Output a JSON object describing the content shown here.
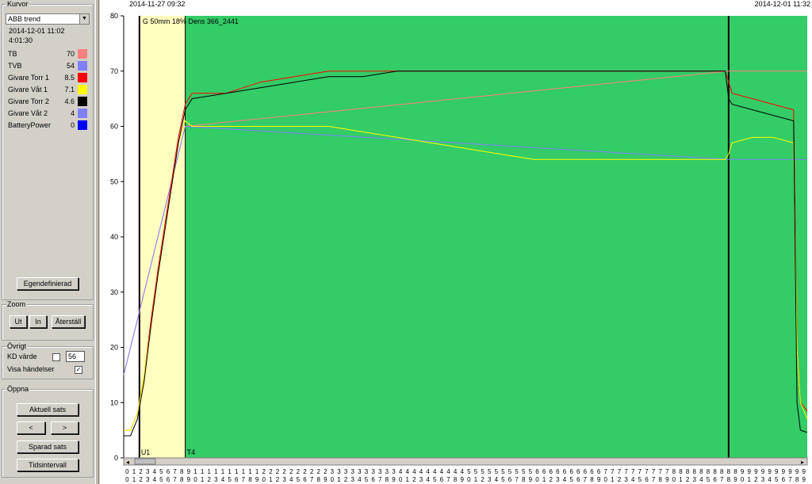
{
  "sidebar": {
    "kurvor": {
      "title": "Kurvor",
      "dropdown_value": "ABB trend",
      "datetime": "2014-12-01 11:02",
      "duration": "4:01:30",
      "legend": [
        {
          "name": "TB",
          "value": "70",
          "color": "#ff8080"
        },
        {
          "name": "TVB",
          "value": "54",
          "color": "#8080ff"
        },
        {
          "name": "Givare Torr 1",
          "value": "8.5",
          "color": "#ff0000"
        },
        {
          "name": "Givare Våt 1",
          "value": "7.1",
          "color": "#ffff00"
        },
        {
          "name": "Givare Torr 2",
          "value": "4.6",
          "color": "#000000"
        },
        {
          "name": "Givare Våt 2",
          "value": "4",
          "color": "#8080ff"
        },
        {
          "name": "BatteryPower",
          "value": "0",
          "color": "#0000ff"
        }
      ],
      "custom_button": "Egendefinierad"
    },
    "zoom": {
      "title": "Zoom",
      "out": "Ut",
      "in": "In",
      "reset": "Återställ"
    },
    "ovrigt": {
      "title": "Övrigt",
      "kd_label": "KD värde",
      "kd_value": "56",
      "kd_checked": false,
      "events_label": "Visa händelser",
      "events_checked": true
    },
    "oppna": {
      "title": "Öppna",
      "current_batch": "Aktuell sats",
      "prev": "<",
      "next": ">",
      "saved_batch": "Sparad sats",
      "time_interval": "Tidsintervall"
    }
  },
  "chart": {
    "start_date": "2014-11-27 09:32",
    "end_date": "2014-12-01 11:32",
    "annotation": "G 50mm 18% Dens 366_2441",
    "marker_u1": "U1",
    "marker_t4": "T4",
    "colors": {
      "plot_bg": "#33cc66",
      "phase1_bg": "#ffffc0"
    }
  },
  "chart_data": {
    "type": "line",
    "ylim": [
      0,
      80
    ],
    "yticks": [
      0,
      10,
      20,
      30,
      40,
      50,
      60,
      70,
      80
    ],
    "x_digit_row1": "0123456789111111111122222222223333333333444444444455555555556666666666777777777788888888889999999999",
    "x_digit_row2": "0123456789012345678901234567890123456789012345678901234567890123456789012345678901234567890123456789",
    "vertical_markers": [
      2.3,
      9,
      88.5
    ],
    "series": [
      {
        "name": "TB",
        "color": "#ff8080",
        "x": [
          0,
          9,
          88.5,
          100
        ],
        "y": [
          15,
          60,
          70,
          70
        ]
      },
      {
        "name": "TVB",
        "color": "#8080ff",
        "x": [
          0,
          9,
          88.5,
          100
        ],
        "y": [
          15,
          60,
          54,
          54
        ]
      },
      {
        "name": "Givare Torr 1",
        "color": "#ff0000",
        "x": [
          0,
          1,
          2,
          3,
          4,
          5,
          6,
          7,
          8,
          9,
          10,
          15,
          20,
          25,
          30,
          35,
          40,
          45,
          50,
          55,
          60,
          65,
          70,
          75,
          80,
          85,
          88,
          88.5,
          89,
          92,
          95,
          98,
          98.5,
          99,
          100
        ],
        "y": [
          5,
          5,
          8,
          15,
          25,
          34,
          42,
          50,
          58,
          64,
          66,
          66,
          68,
          69,
          70,
          70,
          70,
          70,
          70,
          70,
          70,
          70,
          70,
          70,
          70,
          70,
          70,
          68,
          66,
          65,
          64,
          63,
          20,
          10,
          8.5
        ]
      },
      {
        "name": "Givare Våt 1",
        "color": "#ffff00",
        "x": [
          0,
          1,
          2,
          3,
          4,
          5,
          6,
          7,
          8,
          9,
          10,
          15,
          20,
          25,
          30,
          35,
          40,
          45,
          50,
          55,
          60,
          65,
          70,
          75,
          80,
          85,
          88,
          88.5,
          89,
          92,
          95,
          98,
          98.5,
          99,
          100
        ],
        "y": [
          5,
          5,
          8,
          15,
          24,
          33,
          41,
          49,
          57,
          61,
          60,
          60,
          60,
          60,
          60,
          59,
          58,
          57,
          56,
          55,
          54,
          54,
          54,
          54,
          54,
          54,
          54,
          55,
          57,
          58,
          58,
          57,
          20,
          10,
          7.1
        ]
      },
      {
        "name": "Givare Torr 2",
        "color": "#000000",
        "x": [
          0,
          1,
          2,
          3,
          4,
          5,
          6,
          7,
          8,
          9,
          10,
          15,
          20,
          25,
          30,
          35,
          40,
          45,
          50,
          55,
          60,
          65,
          70,
          75,
          80,
          85,
          88,
          88.5,
          89,
          92,
          95,
          98,
          98.5,
          99,
          100
        ],
        "y": [
          4,
          4,
          7,
          14,
          24,
          33,
          41,
          49,
          57,
          63,
          65,
          66,
          67,
          68,
          69,
          69,
          70,
          70,
          70,
          70,
          70,
          70,
          70,
          70,
          70,
          70,
          70,
          65,
          64,
          63,
          62,
          61,
          10,
          5,
          4.6
        ]
      }
    ]
  }
}
